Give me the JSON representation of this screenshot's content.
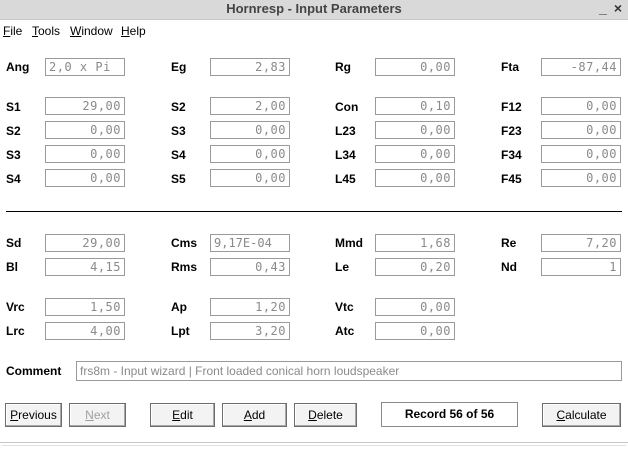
{
  "window": {
    "title": "Hornresp - Input Parameters",
    "minimize": "_",
    "close": "×"
  },
  "menu": [
    {
      "mn": "F",
      "rest": "ile"
    },
    {
      "mn": "T",
      "rest": "ools"
    },
    {
      "mn": "W",
      "rest": "indow"
    },
    {
      "mn": "H",
      "rest": "elp"
    }
  ],
  "params": {
    "ang": {
      "label": "Ang",
      "value": "2,0 x Pi"
    },
    "eg": {
      "label": "Eg",
      "value": "2,83"
    },
    "rg": {
      "label": "Rg",
      "value": "0,00"
    },
    "fta": {
      "label": "Fta",
      "value": "-87,44"
    },
    "s1a": {
      "label": "S1",
      "value": "29,00"
    },
    "s2b": {
      "label": "S2",
      "value": "2,00"
    },
    "con": {
      "label": "Con",
      "value": "0,10"
    },
    "f12": {
      "label": "F12",
      "value": "0,00"
    },
    "s2a": {
      "label": "S2",
      "value": "0,00"
    },
    "s3b": {
      "label": "S3",
      "value": "0,00"
    },
    "l23": {
      "label": "L23",
      "value": "0,00"
    },
    "f23": {
      "label": "F23",
      "value": "0,00"
    },
    "s3a": {
      "label": "S3",
      "value": "0,00"
    },
    "s4b": {
      "label": "S4",
      "value": "0,00"
    },
    "l34": {
      "label": "L34",
      "value": "0,00"
    },
    "f34": {
      "label": "F34",
      "value": "0,00"
    },
    "s4a": {
      "label": "S4",
      "value": "0,00"
    },
    "s5b": {
      "label": "S5",
      "value": "0,00"
    },
    "l45": {
      "label": "L45",
      "value": "0,00"
    },
    "f45": {
      "label": "F45",
      "value": "0,00"
    },
    "sd": {
      "label": "Sd",
      "value": "29,00"
    },
    "cms": {
      "label": "Cms",
      "value": "9,17E-04"
    },
    "mmd": {
      "label": "Mmd",
      "value": "1,68"
    },
    "re": {
      "label": "Re",
      "value": "7,20"
    },
    "bl": {
      "label": "Bl",
      "value": "4,15"
    },
    "rms": {
      "label": "Rms",
      "value": "0,43"
    },
    "le": {
      "label": "Le",
      "value": "0,20"
    },
    "nd": {
      "label": "Nd",
      "value": "1"
    },
    "vrc": {
      "label": "Vrc",
      "value": "1,50"
    },
    "ap": {
      "label": "Ap",
      "value": "1,20"
    },
    "vtc": {
      "label": "Vtc",
      "value": "0,00"
    },
    "lrc": {
      "label": "Lrc",
      "value": "4,00"
    },
    "lpt": {
      "label": "Lpt",
      "value": "3,20"
    },
    "atc": {
      "label": "Atc",
      "value": "0,00"
    }
  },
  "comment": {
    "label": "Comment",
    "value": "frs8m - Input wizard | Front loaded conical horn loudspeaker"
  },
  "buttons": {
    "previous": {
      "mn": "P",
      "rest": "revious"
    },
    "next": {
      "mn": "N",
      "rest": "ext"
    },
    "edit": {
      "mn": "E",
      "rest": "dit"
    },
    "add": {
      "mn": "A",
      "rest": "dd"
    },
    "delete": {
      "mn": "D",
      "rest": "elete"
    },
    "calculate": {
      "mn": "C",
      "rest": "alculate"
    }
  },
  "record": "Record 56 of 56"
}
